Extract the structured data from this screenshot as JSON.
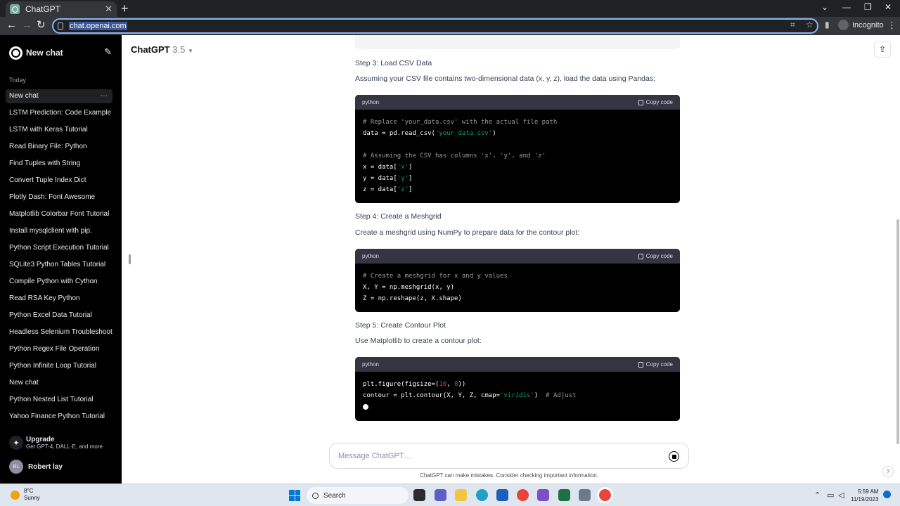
{
  "browser": {
    "tab_title": "ChatGPT",
    "url": "chat.openai.com",
    "profile_label": "Incognito"
  },
  "sidebar": {
    "new_chat_label": "New chat",
    "section_today": "Today",
    "items": [
      "New chat",
      "LSTM Prediction: Code Example",
      "LSTM with Keras Tutorial",
      "Read Binary File: Python",
      "Find Tuples with String",
      "Convert Tuple Index Dict",
      "Plotly Dash: Font Awesome",
      "Matplotlib Colorbar Font Tutorial",
      "Install mysqlclient with pip.",
      "Python Script Execution Tutorial",
      "SQLite3 Python Tables Tutorial",
      "Compile Python with Cython",
      "Read RSA Key Python",
      "Python Excel Data Tutorial",
      "Headless Selenium Troubleshoot",
      "Python Regex File Operation",
      "Python Infinite Loop Tutorial",
      "New chat",
      "Python Nested List Tutorial",
      "Yahoo Finance Python Tutorial"
    ],
    "upgrade": {
      "title": "Upgrade",
      "subtitle": "Get GPT-4, DALL·E, and more"
    },
    "user": {
      "initials": "RL",
      "name": "Robert lay"
    }
  },
  "header": {
    "model_name": "ChatGPT",
    "model_version": "3.5"
  },
  "conversation": {
    "step3_title": "Step 3: Load CSV Data",
    "step3_text": "Assuming your CSV file contains two-dimensional data (x, y, z), load the data using Pandas:",
    "step4_title": "Step 4: Create a Meshgrid",
    "step4_text": "Create a meshgrid using NumPy to prepare data for the contour plot:",
    "step5_title": "Step 5: Create Contour Plot",
    "step5_text": "Use Matplotlib to create a contour plot:",
    "code_lang": "python",
    "copy_label": "Copy code",
    "code1": {
      "l1": "# Replace 'your_data.csv' with the actual file path",
      "l2a": "data = pd.read_csv(",
      "l2b": "'your_data.csv'",
      "l2c": ")",
      "l4": "# Assuming the CSV has columns 'x', 'y', and 'z'",
      "l5a": "x = data[",
      "l5b": "'x'",
      "l5c": "]",
      "l6a": "y = data[",
      "l6b": "'y'",
      "l6c": "]",
      "l7a": "z = data[",
      "l7b": "'z'",
      "l7c": "]"
    },
    "code2": {
      "l1": "# Create a meshgrid for x and y values",
      "l2": "X, Y = np.meshgrid(x, y)",
      "l3": "Z = np.reshape(z, X.shape)"
    },
    "code3": {
      "l1a": "plt.figure(figsize=(",
      "l1b": "10",
      "l1c": ", ",
      "l1d": "8",
      "l1e": "))",
      "l2a": "contour = plt.contour(X, Y, Z, cmap=",
      "l2b": "'viridis'",
      "l2c": ")  ",
      "l2d": "# Adjust"
    }
  },
  "composer": {
    "placeholder": "Message ChatGPT…",
    "disclaimer": "ChatGPT can make mistakes. Consider checking important information.",
    "help_label": "?"
  },
  "taskbar": {
    "weather_temp": "8°C",
    "weather_desc": "Sunny",
    "search_label": "Search",
    "time": "5:59 AM",
    "date": "11/19/2023"
  },
  "colors": {
    "sidebar_bg": "#000000",
    "code_bg": "#000000",
    "code_header_bg": "#343541",
    "string_color": "#00a67d",
    "number_color": "#df3079",
    "omnibox_focus": "#8ab4f8"
  }
}
